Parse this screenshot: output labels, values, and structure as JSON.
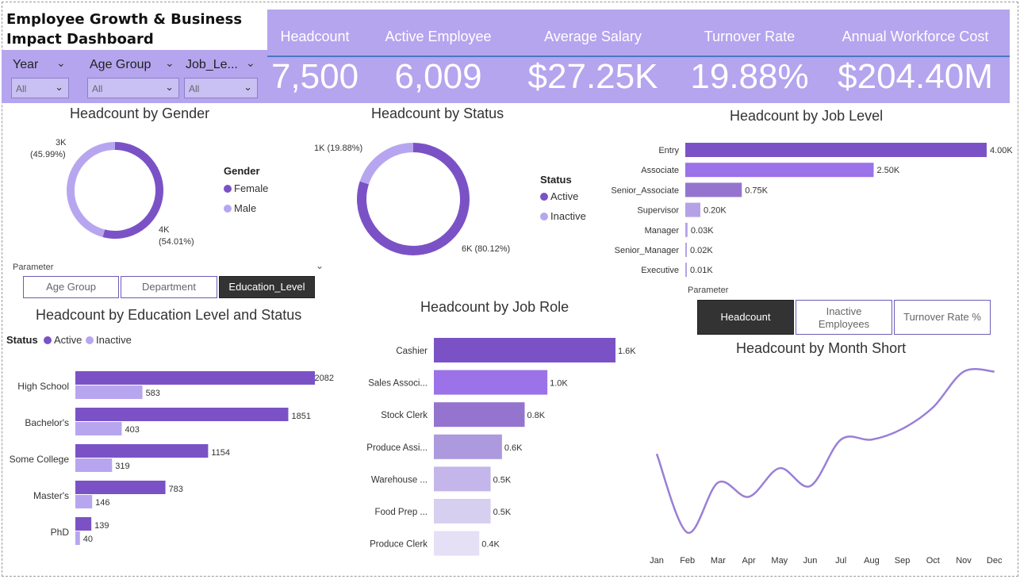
{
  "header": {
    "title": "Employee Growth & Business Impact Dashboard"
  },
  "kpis": [
    {
      "label": "Headcount",
      "value": "7,500"
    },
    {
      "label": "Active Employee",
      "value": "6,009"
    },
    {
      "label": "Average Salary",
      "value": "$27.25K"
    },
    {
      "label": "Turnover Rate",
      "value": "19.88%"
    },
    {
      "label": "Annual Workforce Cost",
      "value": "$204.40M"
    }
  ],
  "slicers": [
    {
      "label": "Year",
      "selected": "All"
    },
    {
      "label": "Age Group",
      "selected": "All"
    },
    {
      "label": "Job_Le...",
      "selected": "All"
    }
  ],
  "colors": {
    "kpi_band": "#b4a5ee",
    "dark_purple": "#7b52c6",
    "light_purple": "#b7a6ef",
    "line": "#9a7fd6"
  },
  "param1": {
    "title": "Parameter",
    "buttons": [
      "Age Group",
      "Department",
      "Education_Level"
    ],
    "selected": 2
  },
  "param2": {
    "title": "Parameter",
    "buttons": [
      "Headcount",
      "Inactive Employees",
      "Turnover Rate %"
    ],
    "selected": 0
  },
  "chart_data": [
    {
      "type": "pie",
      "subtype": "donut",
      "title": "Headcount by Gender",
      "legend_title": "Gender",
      "legend_position": "right",
      "slices": [
        {
          "name": "Female",
          "value": 4056,
          "label": "4K",
          "pct_label": "(54.01%)",
          "color": "#7b52c6"
        },
        {
          "name": "Male",
          "value": 3444,
          "label": "3K",
          "pct_label": "(45.99%)",
          "color": "#b7a6ef"
        }
      ]
    },
    {
      "type": "pie",
      "subtype": "donut",
      "title": "Headcount by Status",
      "legend_title": "Status",
      "legend_position": "right",
      "slices": [
        {
          "name": "Active",
          "value": 6009,
          "label": "6K (80.12%)",
          "color": "#7b52c6"
        },
        {
          "name": "Inactive",
          "value": 1491,
          "label": "1K (19.88%)",
          "color": "#b7a6ef"
        }
      ]
    },
    {
      "type": "bar",
      "orientation": "horizontal",
      "title": "Headcount by Job Level",
      "categories": [
        "Entry",
        "Associate",
        "Senior_Associate",
        "Supervisor",
        "Manager",
        "Senior_Manager",
        "Executive"
      ],
      "values": [
        4000,
        2500,
        750,
        200,
        30,
        20,
        10
      ],
      "labels": [
        "4.00K",
        "2.50K",
        "0.75K",
        "0.20K",
        "0.03K",
        "0.02K",
        "0.01K"
      ],
      "colors": [
        "#7b52c6",
        "#9b72e8",
        "#9574cf",
        "#b5a2e6",
        "#b5a2e6",
        "#b5a2e6",
        "#b5a2e6"
      ]
    },
    {
      "type": "bar",
      "orientation": "horizontal",
      "title": "Headcount by Education Level and Status",
      "legend_title": "Status",
      "legend_position": "top-left",
      "categories": [
        "High School",
        "Bachelor's",
        "Some College",
        "Master's",
        "PhD"
      ],
      "series": [
        {
          "name": "Active",
          "values": [
            2082,
            1851,
            1154,
            783,
            139
          ],
          "color": "#7b52c6"
        },
        {
          "name": "Inactive",
          "values": [
            583,
            403,
            319,
            146,
            40
          ],
          "color": "#b7a6ef"
        }
      ]
    },
    {
      "type": "bar",
      "orientation": "horizontal",
      "title": "Headcount by Job Role",
      "categories": [
        "Cashier",
        "Sales Associ...",
        "Stock Clerk",
        "Produce Assi...",
        "Warehouse ...",
        "Food Prep ...",
        "Produce Clerk"
      ],
      "values": [
        1600,
        1000,
        800,
        600,
        500,
        500,
        400
      ],
      "labels": [
        "1.6K",
        "1.0K",
        "0.8K",
        "0.6K",
        "0.5K",
        "0.5K",
        "0.4K"
      ],
      "colors": [
        "#7b52c6",
        "#9b72e8",
        "#9574cf",
        "#ac99de",
        "#c4b6ea",
        "#d7cfef",
        "#e5e0f6"
      ]
    },
    {
      "type": "line",
      "title": "Headcount by Month Short",
      "x": [
        "Jan",
        "Feb",
        "Mar",
        "Apr",
        "May",
        "Jun",
        "Jul",
        "Aug",
        "Sep",
        "Oct",
        "Nov",
        "Dec"
      ],
      "values": [
        580,
        470,
        540,
        520,
        560,
        535,
        600,
        600,
        615,
        645,
        695,
        695
      ],
      "ylim": [
        455,
        710
      ],
      "grid": false
    }
  ]
}
